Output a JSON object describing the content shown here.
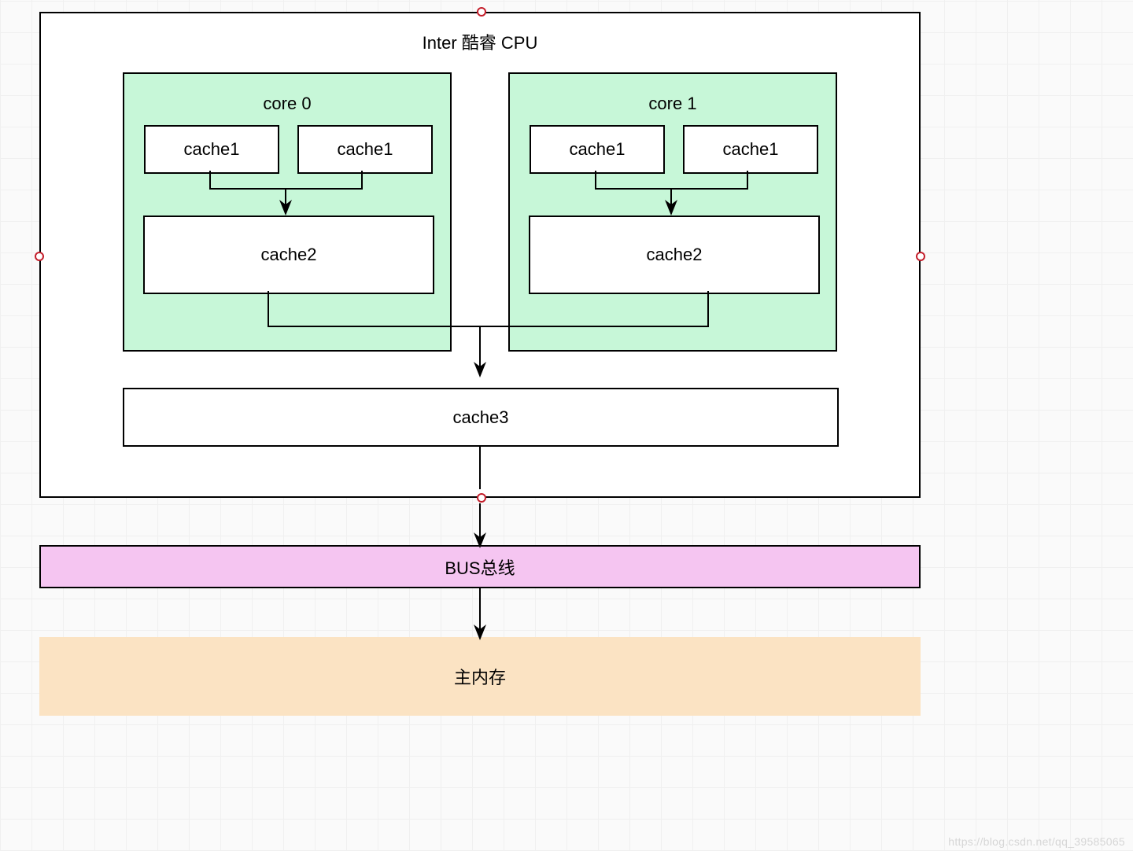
{
  "cpu": {
    "title": "Inter 酷睿 CPU",
    "cores": [
      {
        "name": "core 0",
        "l1a": "cache1",
        "l1b": "cache1",
        "l2": "cache2"
      },
      {
        "name": "core 1",
        "l1a": "cache1",
        "l1b": "cache1",
        "l2": "cache2"
      }
    ],
    "l3": "cache3"
  },
  "bus": {
    "label": "BUS总线"
  },
  "memory": {
    "label": "主内存"
  },
  "watermark": "https://blog.csdn.net/qq_39585065"
}
